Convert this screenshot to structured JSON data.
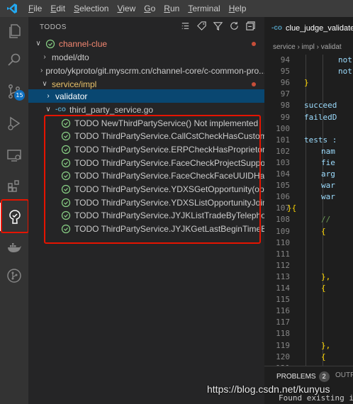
{
  "menubar": {
    "items": [
      {
        "mnemonic": "F",
        "rest": "ile"
      },
      {
        "mnemonic": "E",
        "rest": "dit"
      },
      {
        "mnemonic": "S",
        "rest": "election"
      },
      {
        "mnemonic": "V",
        "rest": "iew"
      },
      {
        "mnemonic": "G",
        "rest": "o"
      },
      {
        "mnemonic": "R",
        "rest": "un"
      },
      {
        "mnemonic": "T",
        "rest": "erminal"
      },
      {
        "mnemonic": "H",
        "rest": "elp"
      }
    ]
  },
  "activitybar": {
    "source_control_badge": "15",
    "highlight_color": "#e51400"
  },
  "sidebar": {
    "title": "TODOS",
    "workspace": "channel-clue",
    "folders": [
      "model/dto",
      "proto/ykproto/git.myscrm.cn/channel-core/c-common-pro...",
      "service/impl"
    ],
    "selected_folder": "validator",
    "file": "third_party_service.go",
    "file_icon": "-co",
    "todos": [
      "TODO NewThirdPartyService() Not implemented",
      "TODO ThirdPartyService.CallCstCheckHasCustomer(t...",
      "TODO ThirdPartyService.ERPCheckHasProprietor(tel...",
      "TODO ThirdPartyService.FaceCheckProjectSupportId...",
      "TODO ThirdPartyService.FaceCheckFaceUUIDHasDao...",
      "TODO ThirdPartyService.YDXSGetOpportunity(oppor...",
      "TODO ThirdPartyService.YDXSListOpportunityJoinCo...",
      "TODO ThirdPartyService.JYJKListTradeByTelephoneA...",
      "TODO ThirdPartyService.JYJKGetLastBeginTimeBooki..."
    ],
    "check_color": "#89d185",
    "accent_selection": "#094771"
  },
  "editor": {
    "tab_icon": "-co",
    "tab_label": "clue_judge_validate_s",
    "breadcrumbs": "service › impl › validat",
    "lines": [
      {
        "n": "94",
        "text": "not",
        "indent": 3
      },
      {
        "n": "95",
        "text": "not",
        "indent": 3
      },
      {
        "n": "96",
        "text": "}",
        "indent": 1
      },
      {
        "n": "97",
        "text": "",
        "indent": 0
      },
      {
        "n": "98",
        "text": "succeed",
        "indent": 1
      },
      {
        "n": "99",
        "text": "failedD",
        "indent": 1
      },
      {
        "n": "100",
        "text": "",
        "indent": 0
      },
      {
        "n": "101",
        "text": "tests :",
        "indent": 1
      },
      {
        "n": "102",
        "text": "nam",
        "indent": 2
      },
      {
        "n": "103",
        "text": "fie",
        "indent": 2
      },
      {
        "n": "104",
        "text": "arg",
        "indent": 2
      },
      {
        "n": "105",
        "text": "war",
        "indent": 2
      },
      {
        "n": "106",
        "text": "war",
        "indent": 2
      },
      {
        "n": "107",
        "text": "}{",
        "indent": 0
      },
      {
        "n": "108",
        "text": "//",
        "indent": 2
      },
      {
        "n": "109",
        "text": "{",
        "indent": 2
      },
      {
        "n": "110",
        "text": "",
        "indent": 0
      },
      {
        "n": "111",
        "text": "",
        "indent": 0
      },
      {
        "n": "112",
        "text": "",
        "indent": 0
      },
      {
        "n": "113",
        "text": "},",
        "indent": 2
      },
      {
        "n": "114",
        "text": "{",
        "indent": 2
      },
      {
        "n": "115",
        "text": "",
        "indent": 0
      },
      {
        "n": "116",
        "text": "",
        "indent": 0
      },
      {
        "n": "117",
        "text": "",
        "indent": 0
      },
      {
        "n": "118",
        "text": "",
        "indent": 0
      },
      {
        "n": "119",
        "text": "},",
        "indent": 2
      },
      {
        "n": "120",
        "text": "{",
        "indent": 2
      },
      {
        "n": "121",
        "text": "",
        "indent": 0
      }
    ]
  },
  "panel": {
    "problems_label": "PROBLEMS",
    "problems_count": "2",
    "output_label": "OUTPU",
    "output_text": "Found existing ins"
  },
  "watermark": "https://blog.csdn.net/kunyus"
}
